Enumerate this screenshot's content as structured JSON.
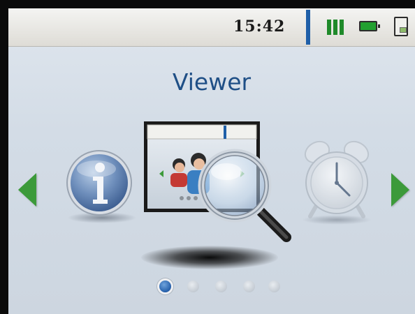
{
  "status_bar": {
    "time": "15:42",
    "signal_icon": "signal-bars-icon",
    "battery_icon": "battery-icon",
    "sim_icon": "sim-card-icon"
  },
  "page": {
    "title": "Viewer"
  },
  "carousel": {
    "nav_left_icon": "left-arrow-icon",
    "nav_right_icon": "right-arrow-icon",
    "items": [
      {
        "app": "information",
        "icon": "info-icon"
      },
      {
        "app": "viewer",
        "icon": "viewer-magnifier-icon",
        "selected": true
      },
      {
        "app": "alarm",
        "icon": "alarm-clock-icon"
      }
    ]
  },
  "pager": {
    "pages": 5,
    "current": 1
  },
  "colors": {
    "title": "#1f4f86",
    "accent": "#3c9a3a",
    "status_bar_divider": "#1f5fa8",
    "active_dot": "#2a64ae"
  }
}
